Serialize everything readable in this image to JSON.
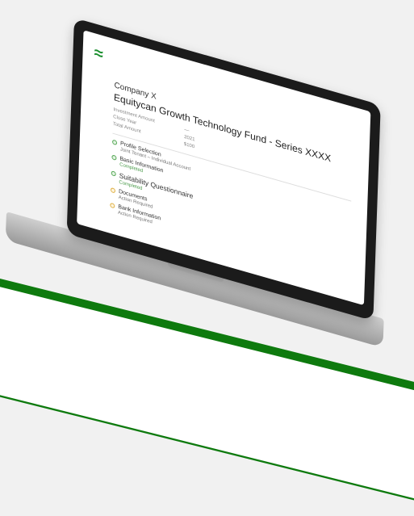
{
  "brand": {
    "logo_glyph": "≈",
    "accent_color": "#1a8f2e",
    "stripe_color": "#0e7a0e"
  },
  "offering": {
    "company": "Company X",
    "title": "Equitycan Growth Technology Fund - Series XXXX",
    "info": [
      {
        "label": "Investment Amount",
        "value": "—"
      },
      {
        "label": "Close Year",
        "value": "2021"
      },
      {
        "label": "Total Amount",
        "value": "$100"
      }
    ]
  },
  "steps": [
    {
      "name": "Profile Selection",
      "detail": "Joint Tenant – Individual Account",
      "status": "done"
    },
    {
      "name": "Basic Information",
      "detail": "Completed",
      "status": "done"
    },
    {
      "name": "Suitability Questionnaire",
      "detail": "Completed",
      "status": "done"
    },
    {
      "name": "Documents",
      "detail": "Action Required",
      "status": "todo"
    },
    {
      "name": "Bank Information",
      "detail": "Action Required",
      "status": "todo"
    }
  ]
}
